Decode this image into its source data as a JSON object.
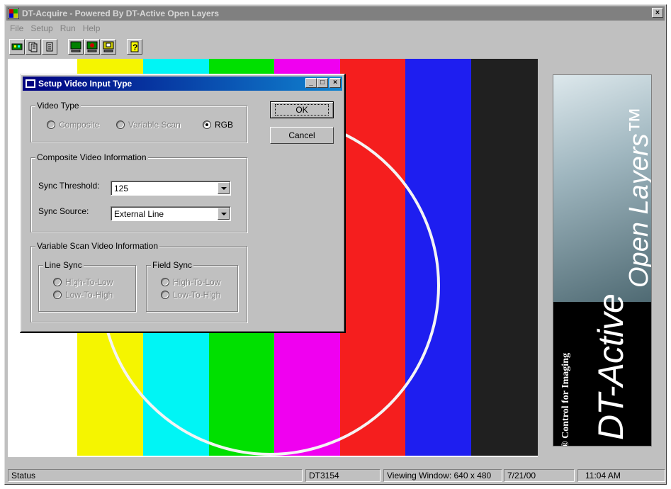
{
  "window": {
    "title": "DT-Acquire - Powered By DT-Active Open Layers",
    "close_glyph": "×"
  },
  "menu": [
    "File",
    "Setup",
    "Run",
    "Help"
  ],
  "toolbar_icons": [
    "board-icon",
    "acquire-icon",
    "acquire-single-icon",
    "live-monitor-icon",
    "freeze-monitor-icon",
    "snapshot-monitor-icon",
    "help-icon"
  ],
  "color_bars": [
    "#ffffff",
    "#f5f500",
    "#00f5f5",
    "#00e000",
    "#f000f0",
    "#f51e1e",
    "#1e1ef0",
    "#202020",
    "#000000"
  ],
  "dialog": {
    "title": "Setup Video Input Type",
    "min_glyph": "_",
    "max_glyph": "□",
    "close_glyph": "×",
    "ok": "OK",
    "cancel": "Cancel",
    "video_type": {
      "label": "Video Type",
      "composite": "Composite",
      "variable_scan": "Variable Scan",
      "rgb": "RGB",
      "selected": "RGB"
    },
    "composite_info": {
      "label": "Composite Video Information",
      "sync_threshold_label": "Sync Threshold:",
      "sync_threshold_value": "125",
      "sync_source_label": "Sync Source:",
      "sync_source_value": "External Line"
    },
    "variable_scan": {
      "label": "Variable Scan Video Information",
      "line_sync": "Line Sync",
      "field_sync": "Field Sync",
      "high_to_low": "High-To-Low",
      "low_to_high": "Low-To-High"
    }
  },
  "logo": {
    "brand_line1": "DT-Active",
    "brand_line2": "Open Layers™",
    "tagline": "ActiveX® Control for Imaging"
  },
  "status": {
    "status": "Status",
    "board": "DT3154",
    "viewing": "Viewing Window: 640 x 480",
    "date": "7/21/00",
    "time": "11:04 AM"
  }
}
